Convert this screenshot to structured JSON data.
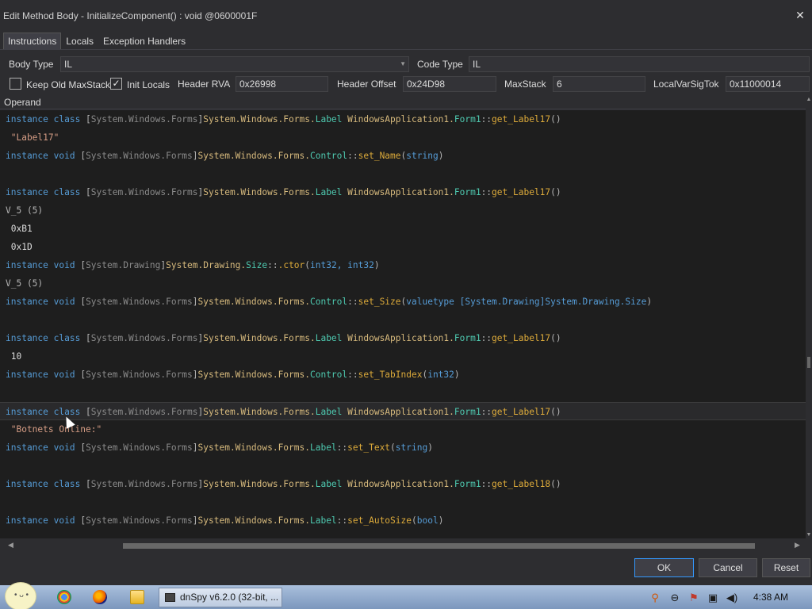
{
  "window": {
    "title": "Edit Method Body - InitializeComponent() : void @0600001F",
    "close_glyph": "✕"
  },
  "tabs": [
    {
      "label": "Instructions",
      "active": true
    },
    {
      "label": "Locals",
      "active": false
    },
    {
      "label": "Exception Handlers",
      "active": false
    }
  ],
  "body_type": {
    "label": "Body Type",
    "value": "IL"
  },
  "code_type": {
    "label": "Code Type",
    "value": "IL"
  },
  "options": {
    "keep_old_maxstack": {
      "label": "Keep Old MaxStack",
      "checked": false
    },
    "init_locals": {
      "label": "Init Locals",
      "checked": true
    },
    "header_rva": {
      "label": "Header RVA",
      "value": "0x26998"
    },
    "header_offset": {
      "label": "Header Offset",
      "value": "0x24D98"
    },
    "maxstack": {
      "label": "MaxStack",
      "value": "6"
    },
    "local_var_sig_tok": {
      "label": "LocalVarSigTok",
      "value": "0x11000014"
    }
  },
  "grid": {
    "column_header": "Operand",
    "selected_row": 16,
    "rows": [
      {
        "kind": "call",
        "parts": [
          "instance",
          " class ",
          "[",
          "System.Windows.Forms",
          "]",
          "System.Windows.Forms.",
          "Label",
          " ",
          "WindowsApplication1.",
          "Form1",
          "::",
          "get_Label17",
          "()"
        ]
      },
      {
        "kind": "str",
        "text": "\"Label17\""
      },
      {
        "kind": "call",
        "parts": [
          "instance",
          " void ",
          "[",
          "System.Windows.Forms",
          "]",
          "System.Windows.Forms.",
          "Control",
          "::",
          "set_Name",
          "(",
          "string",
          ")"
        ]
      },
      {
        "kind": "empty",
        "text": ""
      },
      {
        "kind": "call",
        "parts": [
          "instance",
          " class ",
          "[",
          "System.Windows.Forms",
          "]",
          "System.Windows.Forms.",
          "Label",
          " ",
          "WindowsApplication1.",
          "Form1",
          "::",
          "get_Label17",
          "()"
        ]
      },
      {
        "kind": "plain",
        "text": "V_5 (5)"
      },
      {
        "kind": "num",
        "text": "0xB1"
      },
      {
        "kind": "num",
        "text": "0x1D"
      },
      {
        "kind": "call",
        "parts": [
          "instance",
          " void ",
          "[",
          "System.Drawing",
          "]",
          "System.Drawing.",
          "Size",
          "::",
          ".ctor",
          "(",
          "int32, int32",
          ")"
        ]
      },
      {
        "kind": "plain",
        "text": "V_5 (5)"
      },
      {
        "kind": "call",
        "parts": [
          "instance",
          " void ",
          "[",
          "System.Windows.Forms",
          "]",
          "System.Windows.Forms.",
          "Control",
          "::",
          "set_Size",
          "(",
          "valuetype [System.Drawing]System.Drawing.Size",
          ")"
        ]
      },
      {
        "kind": "empty",
        "text": ""
      },
      {
        "kind": "call",
        "parts": [
          "instance",
          " class ",
          "[",
          "System.Windows.Forms",
          "]",
          "System.Windows.Forms.",
          "Label",
          " ",
          "WindowsApplication1.",
          "Form1",
          "::",
          "get_Label17",
          "()"
        ]
      },
      {
        "kind": "num",
        "text": "10"
      },
      {
        "kind": "call",
        "parts": [
          "instance",
          " void ",
          "[",
          "System.Windows.Forms",
          "]",
          "System.Windows.Forms.",
          "Control",
          "::",
          "set_TabIndex",
          "(",
          "int32",
          ")"
        ]
      },
      {
        "kind": "empty",
        "text": ""
      },
      {
        "kind": "call",
        "parts": [
          "instance",
          " class ",
          "[",
          "System.Windows.Forms",
          "]",
          "System.Windows.Forms.",
          "Label",
          " ",
          "WindowsApplication1.",
          "Form1",
          "::",
          "get_Label17",
          "()"
        ]
      },
      {
        "kind": "str",
        "text": "\"Botnets Online:\""
      },
      {
        "kind": "call",
        "parts": [
          "instance",
          " void ",
          "[",
          "System.Windows.Forms",
          "]",
          "System.Windows.Forms.",
          "Label",
          "::",
          "set_Text",
          "(",
          "string",
          ")"
        ]
      },
      {
        "kind": "empty",
        "text": ""
      },
      {
        "kind": "call",
        "parts": [
          "instance",
          " class ",
          "[",
          "System.Windows.Forms",
          "]",
          "System.Windows.Forms.",
          "Label",
          " ",
          "WindowsApplication1.",
          "Form1",
          "::",
          "get_Label18",
          "()"
        ]
      },
      {
        "kind": "empty",
        "text": ""
      },
      {
        "kind": "call",
        "parts": [
          "instance",
          " void ",
          "[",
          "System.Windows.Forms",
          "]",
          "System.Windows.Forms.",
          "Label",
          "::",
          "set_AutoSize",
          "(",
          "bool",
          ")"
        ]
      }
    ]
  },
  "buttons": {
    "ok": "OK",
    "cancel": "Cancel",
    "reset": "Reset"
  },
  "taskbar": {
    "task_label": "dnSpy v6.2.0 (32-bit, ...",
    "clock": "4:38 AM",
    "icons": [
      "start-orb",
      "chrome-icon",
      "firefox-icon",
      "explorer-folder-icon"
    ]
  }
}
